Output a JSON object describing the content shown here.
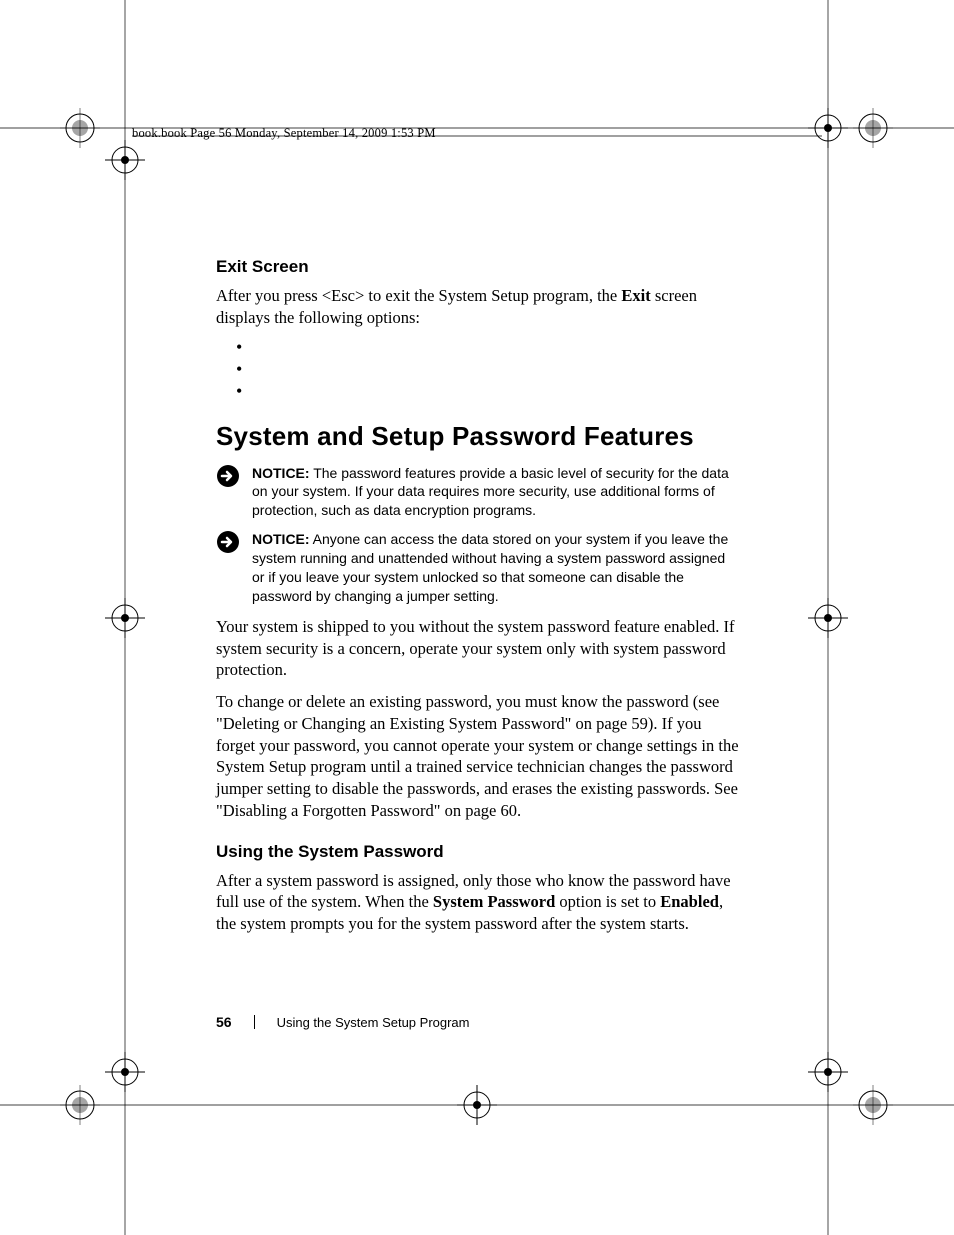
{
  "header": {
    "crop_line": "book.book  Page 56  Monday, September 14, 2009  1:53 PM"
  },
  "sections": {
    "exit_screen": {
      "heading": "Exit Screen",
      "intro_before_bold": "After you press <Esc> to exit the System Setup program, the ",
      "intro_bold": "Exit",
      "intro_after_bold": " screen displays the following options:"
    },
    "main_heading": "System and Setup Password Features",
    "notice1": {
      "label": "NOTICE:",
      "text": " The password features provide a basic level of security for the data on your system. If your data requires more security, use additional forms of protection, such as data encryption programs."
    },
    "notice2": {
      "label": "NOTICE:",
      "text": " Anyone can access the data stored on your system if you leave the system running and unattended without having a system password assigned or if you leave your system unlocked so that someone can disable the password by changing a jumper setting."
    },
    "para1": "Your system is shipped to you without the system password feature enabled. If system security is a concern, operate your system only with system password protection.",
    "para2": "To change or delete an existing password, you must know the password (see \"Deleting or Changing an Existing System Password\" on page 59). If you forget your password, you cannot operate your system or change settings in the System Setup program until a trained service technician changes the password jumper setting to disable the passwords, and erases the existing passwords. See \"Disabling a Forgotten Password\" on page 60.",
    "using_heading": "Using the System Password",
    "using_para_before1": "After a system password is assigned, only those who know the password have full use of the system. When the ",
    "using_bold1": "System Password",
    "using_mid": " option is set to ",
    "using_bold2": "Enabled",
    "using_after": ", the system prompts you for the system password after the system starts."
  },
  "footer": {
    "page_number": "56",
    "section_title": "Using the System Setup Program"
  },
  "icons": {
    "notice": "notice-arrow-icon",
    "regmark": "registration-mark-icon"
  }
}
